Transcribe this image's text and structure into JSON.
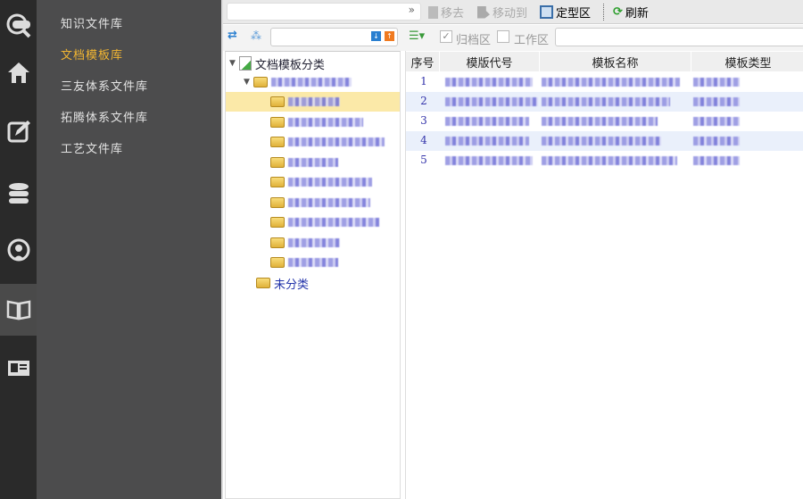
{
  "sidebar": {
    "icons": [
      "sipm-search-icon",
      "home-icon",
      "edit-icon",
      "database-icon",
      "broadcast-icon",
      "book-icon",
      "contact-card-icon"
    ],
    "menu": [
      "知识文件库",
      "文档模板库",
      "三友体系文件库",
      "拓腾体系文件库",
      "工艺文件库"
    ],
    "active_index": 1
  },
  "toolbar": {
    "remove": "移去",
    "move_to": "移动到",
    "fixed_area": "定型区",
    "refresh": "刷新"
  },
  "filter": {
    "archive_label": "归档区",
    "archive_checked": true,
    "work_label": "工作区",
    "work_checked": false
  },
  "tree": {
    "root": "文档模板分类",
    "uncategorized": "未分类"
  },
  "grid": {
    "columns": [
      "序号",
      "模版代号",
      "模板名称",
      "模板类型"
    ],
    "rows": [
      "1",
      "2",
      "3",
      "4",
      "5"
    ]
  },
  "colors": {
    "accent": "#f2b632",
    "selected_row": "#fbe9a8"
  }
}
